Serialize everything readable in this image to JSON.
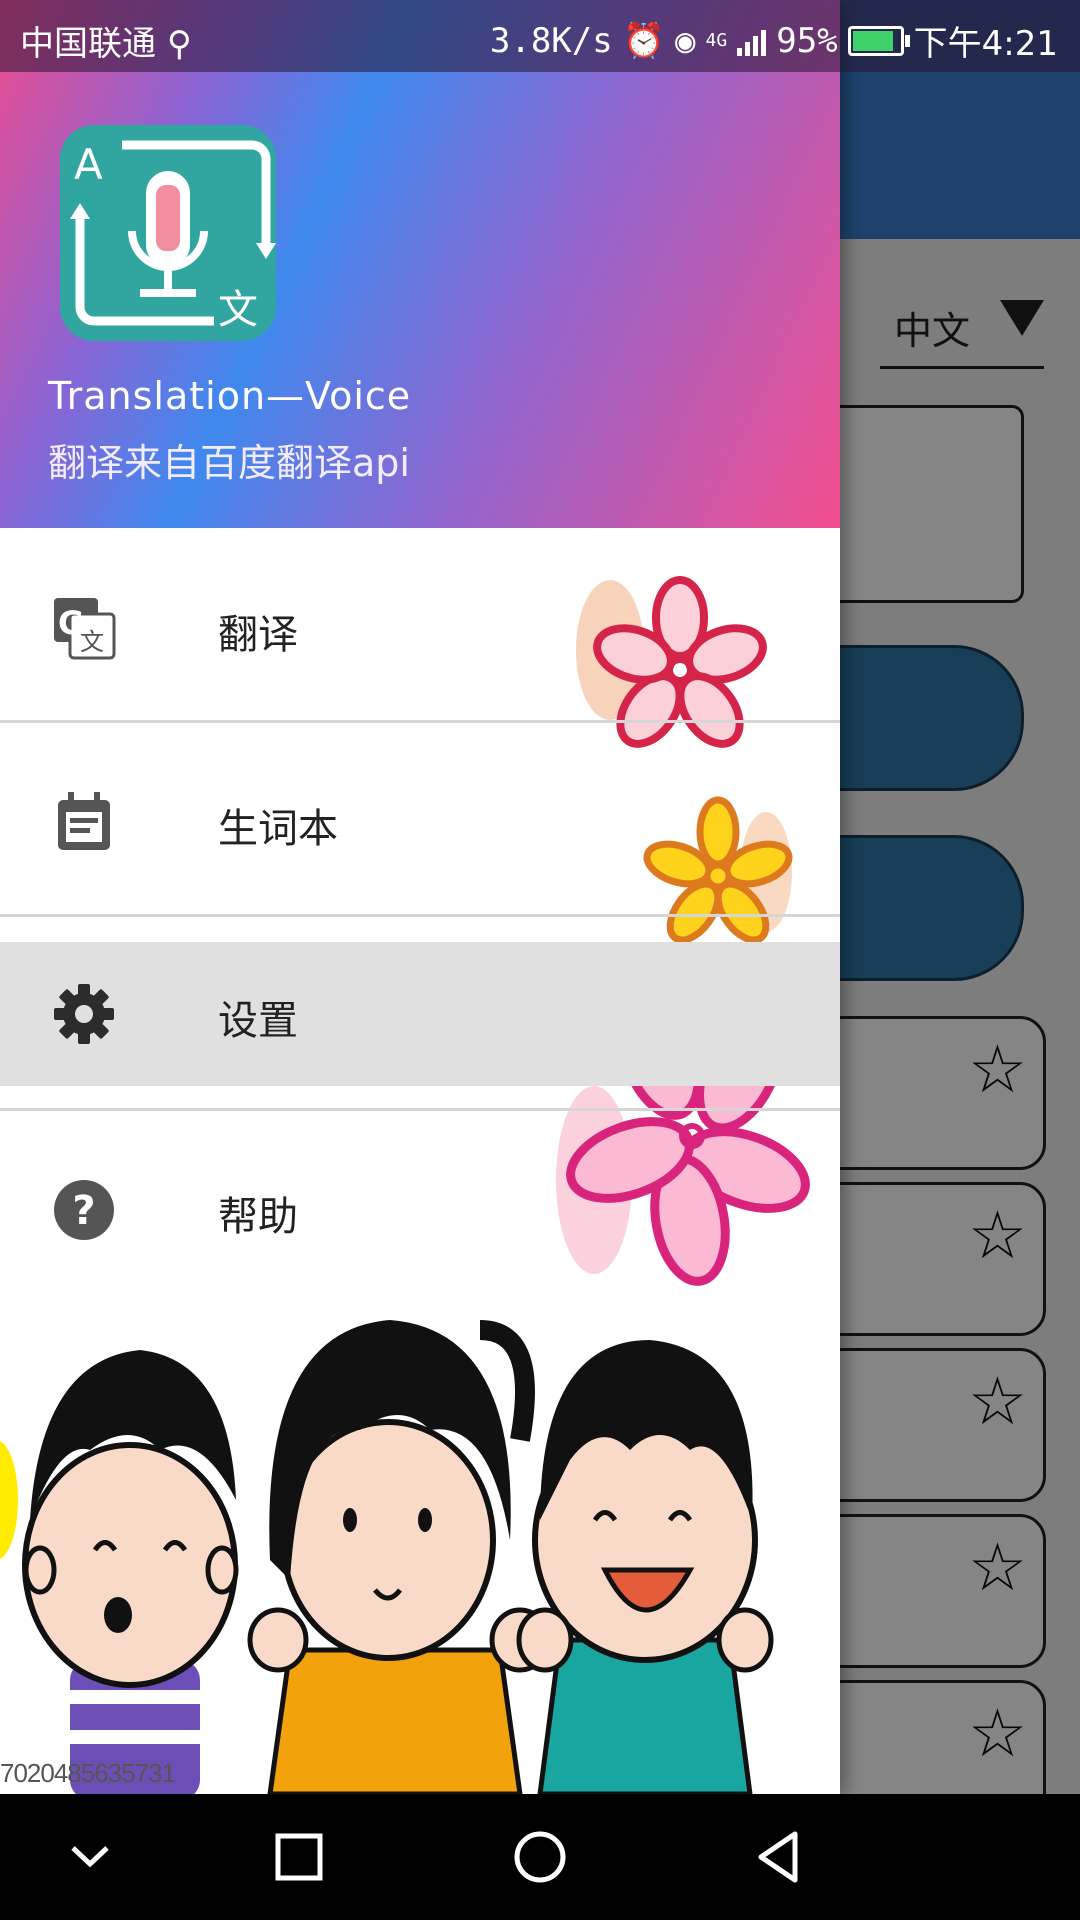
{
  "status_bar": {
    "carrier": "中国联通",
    "speed": "3.8K/s",
    "network": "4G",
    "battery": "95%",
    "time": "下午4:21"
  },
  "drawer": {
    "app_name": "Translation—Voice",
    "subtitle": "翻译来自百度翻译api",
    "logo_letter_a": "A",
    "logo_letter_zh": "文",
    "items": [
      {
        "label": "翻译",
        "icon": "translate-icon"
      },
      {
        "label": "生词本",
        "icon": "notebook-icon"
      },
      {
        "label": "设置",
        "icon": "gear-icon",
        "selected": true
      },
      {
        "label": "帮助",
        "icon": "help-icon"
      }
    ],
    "watermark": "7020485635731"
  },
  "background_app": {
    "language": "中文",
    "colors": {
      "toolbar": "#3a7fd1",
      "button": "#2e7aa8"
    }
  }
}
